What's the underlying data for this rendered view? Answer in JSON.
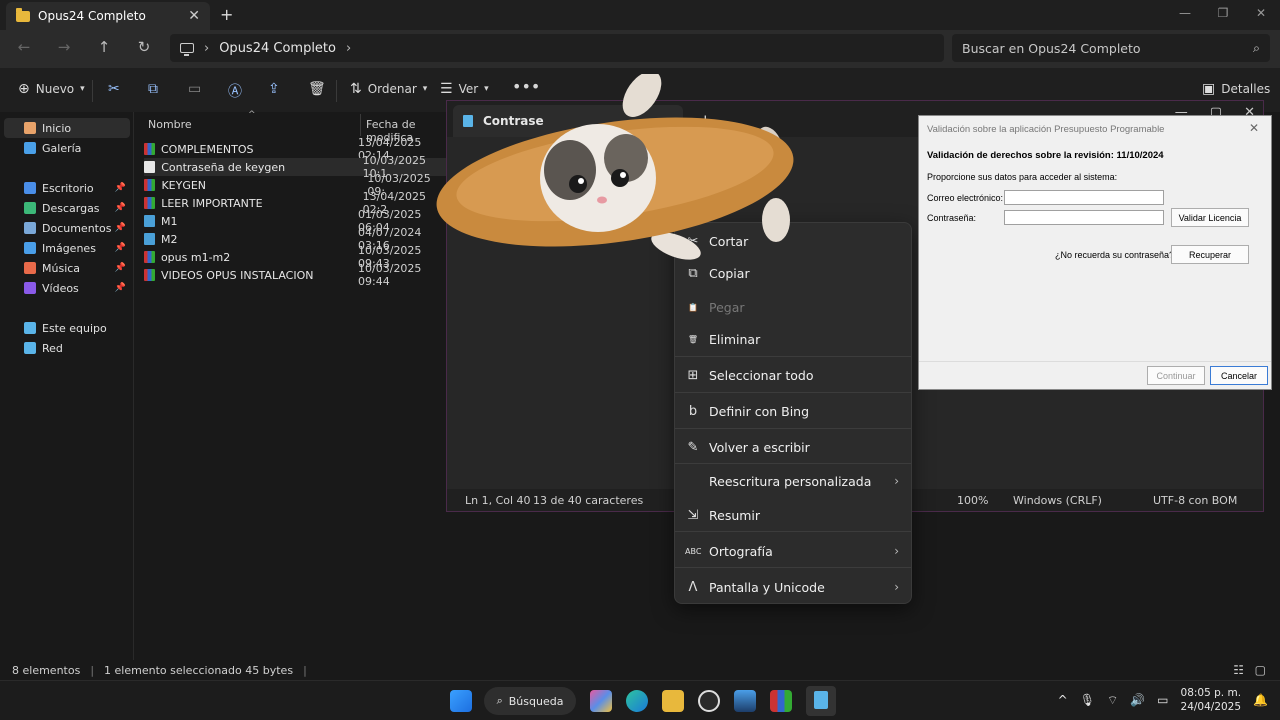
{
  "explorer": {
    "tab_title": "Opus24 Completo",
    "breadcrumb": "Opus24 Completo",
    "search_placeholder": "Buscar en Opus24 Completo",
    "commands": {
      "new": "Nuevo",
      "sort": "Ordenar",
      "view": "Ver",
      "details": "Detalles"
    },
    "nav": [
      {
        "label": "Inicio",
        "icon": "home-icon",
        "color": "#e8a36a",
        "selected": true
      },
      {
        "label": "Galería",
        "icon": "gallery-icon",
        "color": "#4aa0e8",
        "selected": false
      },
      {
        "label": "Escritorio",
        "icon": "desktop-icon",
        "color": "#4a8ee8",
        "pinned": true
      },
      {
        "label": "Descargas",
        "icon": "download-icon",
        "color": "#3cb878",
        "pinned": true
      },
      {
        "label": "Documentos",
        "icon": "documents-icon",
        "color": "#7aa8d8",
        "pinned": true
      },
      {
        "label": "Imágenes",
        "icon": "images-icon",
        "color": "#4a9ee8",
        "pinned": true
      },
      {
        "label": "Música",
        "icon": "music-icon",
        "color": "#e86a4a",
        "pinned": true
      },
      {
        "label": "Vídeos",
        "icon": "videos-icon",
        "color": "#8a5ae8",
        "pinned": true
      },
      {
        "label": "Este equipo",
        "icon": "pc-icon",
        "color": "#5ab4e8"
      },
      {
        "label": "Red",
        "icon": "network-icon",
        "color": "#5ab4e8"
      }
    ],
    "columns": {
      "name": "Nombre",
      "date": "Fecha de modifica"
    },
    "files": [
      {
        "name": "COMPLEMENTOS",
        "date": "13/04/2025 02:14",
        "type": "rar"
      },
      {
        "name": "Contraseña de keygen",
        "date": "10/03/2025 10:1",
        "type": "txt",
        "selected": true
      },
      {
        "name": "KEYGEN",
        "date": "10/03/2025 09:",
        "type": "rar"
      },
      {
        "name": "LEER IMPORTANTE",
        "date": "13/04/2025 02:2",
        "type": "rar"
      },
      {
        "name": "M1",
        "date": "01/03/2025 06:04",
        "type": "vid"
      },
      {
        "name": "M2",
        "date": "04/07/2024 03:16",
        "type": "vid"
      },
      {
        "name": "opus m1-m2",
        "date": "10/03/2025 09:43",
        "type": "rar"
      },
      {
        "name": "VIDEOS OPUS INSTALACION",
        "date": "10/03/2025 09:44",
        "type": "rar"
      }
    ],
    "status": {
      "count": "8 elementos",
      "selection": "1 elemento seleccionado  45 bytes"
    }
  },
  "notepad": {
    "tab_title": "Contrase",
    "status": {
      "position": "Ln 1, Col 40",
      "chars": "13 de 40 caracteres",
      "zoom": "100%",
      "eol": "Windows (CRLF)",
      "encoding": "UTF-8 con BOM"
    }
  },
  "context_menu": {
    "items": [
      {
        "label": "Cortar",
        "icon": "cut-icon",
        "glyph": "✂"
      },
      {
        "label": "Copiar",
        "icon": "copy-icon",
        "glyph": "⧉"
      },
      {
        "label": "Pegar",
        "icon": "paste-icon",
        "glyph": "📋",
        "disabled": true
      },
      {
        "label": "Eliminar",
        "icon": "trash-icon",
        "glyph": "🗑"
      },
      {
        "label": "Seleccionar todo",
        "icon": "select-all-icon",
        "glyph": "⊞"
      },
      {
        "label": "Definir con Bing",
        "icon": "bing-icon",
        "glyph": "b"
      },
      {
        "label": "Volver a escribir",
        "icon": "rewrite-icon",
        "glyph": "✎"
      },
      {
        "label": "Reescritura personalizada",
        "icon": "",
        "glyph": "",
        "submenu": true
      },
      {
        "label": "Resumir",
        "icon": "summarize-icon",
        "glyph": "⇲"
      },
      {
        "label": "Ortografía",
        "icon": "spelling-icon",
        "glyph": "ABC",
        "submenu": true
      },
      {
        "label": "Pantalla y Unicode",
        "icon": "unicode-icon",
        "glyph": "Λ",
        "submenu": true
      }
    ]
  },
  "dialog": {
    "title": "Validación sobre la aplicación Presupuesto Programable",
    "heading": "Validación de derechos sobre la revisión: 11/10/2024",
    "prompt": "Proporcione sus datos para acceder al sistema:",
    "email_label": "Correo electrónico:",
    "password_label": "Contraseña:",
    "validate_button": "Validar Licencia",
    "forgot_text": "¿No recuerda su contraseña?",
    "recover_button": "Recuperar",
    "continue_button": "Continuar",
    "cancel_button": "Cancelar"
  },
  "taskbar": {
    "search_label": "Búsqueda",
    "time": "08:05 p. m.",
    "date": "24/04/2025"
  }
}
